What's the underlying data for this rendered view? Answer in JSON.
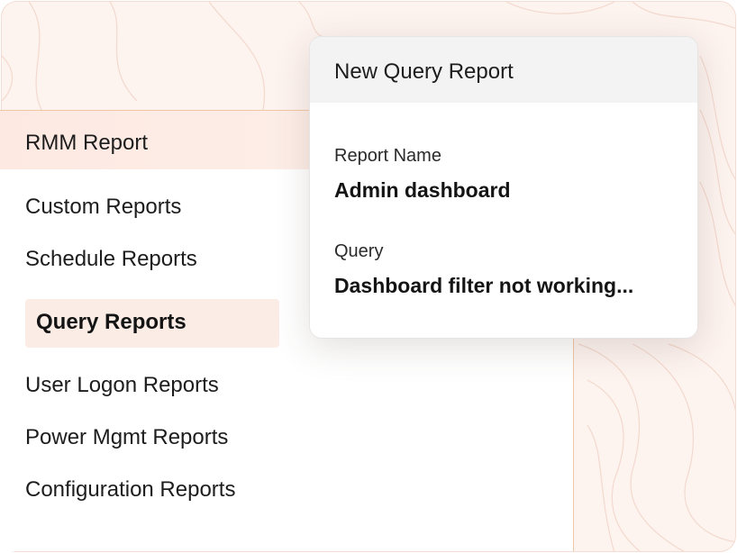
{
  "sidebar": {
    "header": "RMM Report",
    "items": [
      {
        "label": "Custom Reports",
        "active": false
      },
      {
        "label": "Schedule Reports",
        "active": false
      },
      {
        "label": "Query Reports",
        "active": true
      },
      {
        "label": "User Logon Reports",
        "active": false
      },
      {
        "label": "Power Mgmt Reports",
        "active": false
      },
      {
        "label": "Configuration Reports",
        "active": false
      }
    ]
  },
  "card": {
    "title": "New Query Report",
    "fields": [
      {
        "label": "Report Name",
        "value": "Admin dashboard"
      },
      {
        "label": "Query",
        "value": "Dashboard filter not working..."
      }
    ]
  },
  "colors": {
    "background": "#fdf3ef",
    "accent_line": "#f0c7a6",
    "active_item_bg": "#fcece6",
    "card_header_bg": "#f3f3f3"
  }
}
